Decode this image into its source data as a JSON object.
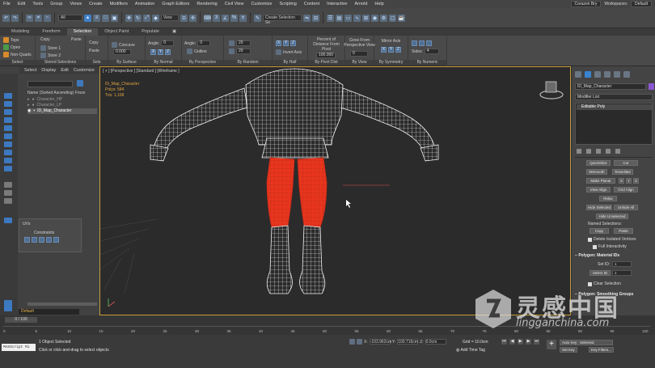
{
  "menu": {
    "items": [
      "File",
      "Edit",
      "Tools",
      "Group",
      "Views",
      "Create",
      "Modifiers",
      "Animation",
      "Graph Editors",
      "Rendering",
      "Civil View",
      "Customize",
      "Scripting",
      "Content",
      "Interactive",
      "Arnold",
      "Help"
    ],
    "user": "Corazon Bry",
    "workspaces_label": "Workspaces:",
    "workspace": "Default"
  },
  "toolbar": {
    "view_dropdown": "View",
    "selection_set": "Create Selection Se"
  },
  "ribbon": {
    "tabs": [
      "Modeling",
      "Freeform",
      "Selection",
      "Object Paint",
      "Populate"
    ],
    "active_tab": "Selection",
    "groups": {
      "select": {
        "label": "Select",
        "tops": "Tops",
        "open": "Open",
        "non_quads": "Non-Quads"
      },
      "stored": {
        "label": "Stored Selections",
        "copy": "Copy",
        "paste": "Paste",
        "store1": "Store 1",
        "store2": "Store 2"
      },
      "sets": {
        "label": "Sets",
        "copy": "Copy",
        "paste": "Paste"
      },
      "by_surface": {
        "label": "By Surface",
        "concave": "Concave",
        "value": "0.000"
      },
      "by_normal": {
        "label": "By Normal",
        "angle_label": "Angle:",
        "angle": "0",
        "x": "X",
        "y": "Y",
        "z": "Z"
      },
      "by_perspective": {
        "label": "By Perspective",
        "angle_label": "Angle:",
        "angle": "0",
        "outline": "Outline"
      },
      "by_random": {
        "label": "By Random",
        "v1": "20",
        "v2": "20"
      },
      "by_half": {
        "label": "By Half",
        "x": "X",
        "y": "Y",
        "z": "Z",
        "invert": "Invert Axis"
      },
      "by_pivot": {
        "label": "By Pivot Dist",
        "line1": "Percent of",
        "line2": "Distance From",
        "line3": "Pivot",
        "value": "100.000"
      },
      "by_view": {
        "label": "By View",
        "line1": "Grow From",
        "line2": "Perspective View",
        "value": "0"
      },
      "by_symmetry": {
        "label": "By Symmetry",
        "mirror": "Mirror Axis",
        "x": "X",
        "y": "Y",
        "z": "Z"
      },
      "by_numeric": {
        "label": "By Numeric",
        "sides_label": "Sides:",
        "sides": "4"
      }
    }
  },
  "scene_explorer": {
    "menu": [
      "Select",
      "Display",
      "Edit",
      "Customize"
    ],
    "header": "Name (Sorted Ascending)",
    "frozen_label": "Froze",
    "items": [
      "Character_HP",
      "Character_LP",
      "ID_Map_Character"
    ],
    "selected": "ID_Map_Character",
    "float_panel": {
      "title": "UVs",
      "constraints": "Constraints"
    },
    "layer": "Default"
  },
  "viewport": {
    "label": "[ + ] [Perspective ] [Standard ] [Wireframe ]",
    "object_name": "ID_Map_Character",
    "polys_label": "Polys:",
    "polys": "584",
    "tris_label": "Tris:",
    "tris": "1,168",
    "selection_color": "#e8351e",
    "wire_color": "#f2f2f2"
  },
  "command_panel": {
    "object_name": "ID_Map_Character",
    "object_color": "#8b56d0",
    "modifier_list": "Modifier List",
    "stack_item": "Editable Poly",
    "buttons": {
      "quickslice": "QuickSlice",
      "cut": "Cut",
      "msmooth": "MSmooth",
      "tessellate": "Tessellate",
      "make_planar": "Make Planar",
      "x": "X",
      "y": "Y",
      "z": "Z",
      "view_align": "View Align",
      "grid_align": "Grid Align",
      "relax": "Relax",
      "hide_selected": "Hide Selected",
      "unhide_all": "Unhide All",
      "hide_unselected": "Hide Unselected",
      "copy": "Copy",
      "paste": "Paste"
    },
    "named_selections": "Named Selections:",
    "delete_isolated": "Delete Isolated Vertices",
    "full_interactivity": "Full Interactivity",
    "material_ids": "Polygon: Material IDs",
    "set_id_label": "Set ID:",
    "set_id": "1",
    "select_id_label": "Select ID",
    "select_id": "1",
    "clear_selection": "Clear Selection",
    "smoothing_groups": "Polygon: Smoothing Groups"
  },
  "timeline": {
    "frame": "0 / 100",
    "ticks": [
      "0",
      "5",
      "10",
      "15",
      "20",
      "25",
      "30",
      "35",
      "40",
      "45",
      "50",
      "55",
      "60",
      "65",
      "70",
      "75",
      "80",
      "85",
      "90",
      "95",
      "100"
    ]
  },
  "status": {
    "maxscript": "MAXScript Mi",
    "object_selected": "1 Object Selected",
    "hint": "Click or click-and-drag to select objects",
    "x_label": "X:",
    "x": "-103.962cm",
    "y_label": "Y:",
    "y": "100.716cm",
    "z_label": "Z:",
    "z": "0.0cm",
    "grid": "Grid = 10.0cm",
    "add_time_tag": "Add Time Tag",
    "auto_key": "Auto Key",
    "selected": "Selected",
    "set_key": "Set Key",
    "key_filters": "Key Filters..."
  },
  "watermark": {
    "cn": "灵感中国",
    "en": "lingganchina.com"
  }
}
